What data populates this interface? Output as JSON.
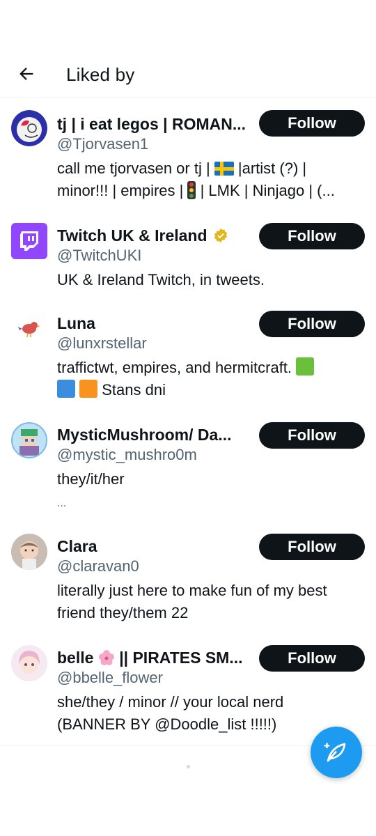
{
  "header": {
    "title": "Liked by"
  },
  "users": [
    {
      "name": "tj | i eat legos | ROMAN...",
      "handle": "@Tjorvasen1",
      "bio_1": "call me tjorvasen or tj | ",
      "bio_2": " |artist (?) |",
      "bio_3": "minor!!! | empires | ",
      "bio_4": " | LMK | Ninjago | (...",
      "follow_label": "Follow"
    },
    {
      "name": "Twitch UK & Ireland",
      "handle": "@TwitchUKI",
      "bio": "UK & Ireland Twitch, in tweets.",
      "follow_label": "Follow"
    },
    {
      "name": "Luna",
      "handle": "@lunxrstellar",
      "bio_1": "traffictwt, empires, and hermitcraft. ",
      "bio_2": " Stans dni",
      "follow_label": "Follow"
    },
    {
      "name": "MysticMushroom/ Da...",
      "handle": "@mystic_mushro0m",
      "bio_1": "they/it/her",
      "bio_2": "...",
      "follow_label": "Follow"
    },
    {
      "name": "Clara",
      "handle": "@claravan0",
      "bio_1": "literally just here to make fun of my best",
      "bio_2": "friend they/them 22",
      "follow_label": "Follow"
    },
    {
      "name_1": "belle ",
      "name_2": " || PIRATES SM...",
      "handle": "@bbelle_flower",
      "bio_1": "she/they / minor // your local nerd",
      "bio_2": "(BANNER BY @Doodle_list !!!!!)",
      "follow_label": "Follow"
    }
  ],
  "colors": {
    "accent": "#1d9bf0",
    "text": "#0f1419",
    "secondary": "#536471",
    "button": "#0f1419"
  },
  "icons": {
    "back": "arrow-left-icon",
    "verified": "verified-badge-icon",
    "compose": "compose-tweet-icon"
  }
}
